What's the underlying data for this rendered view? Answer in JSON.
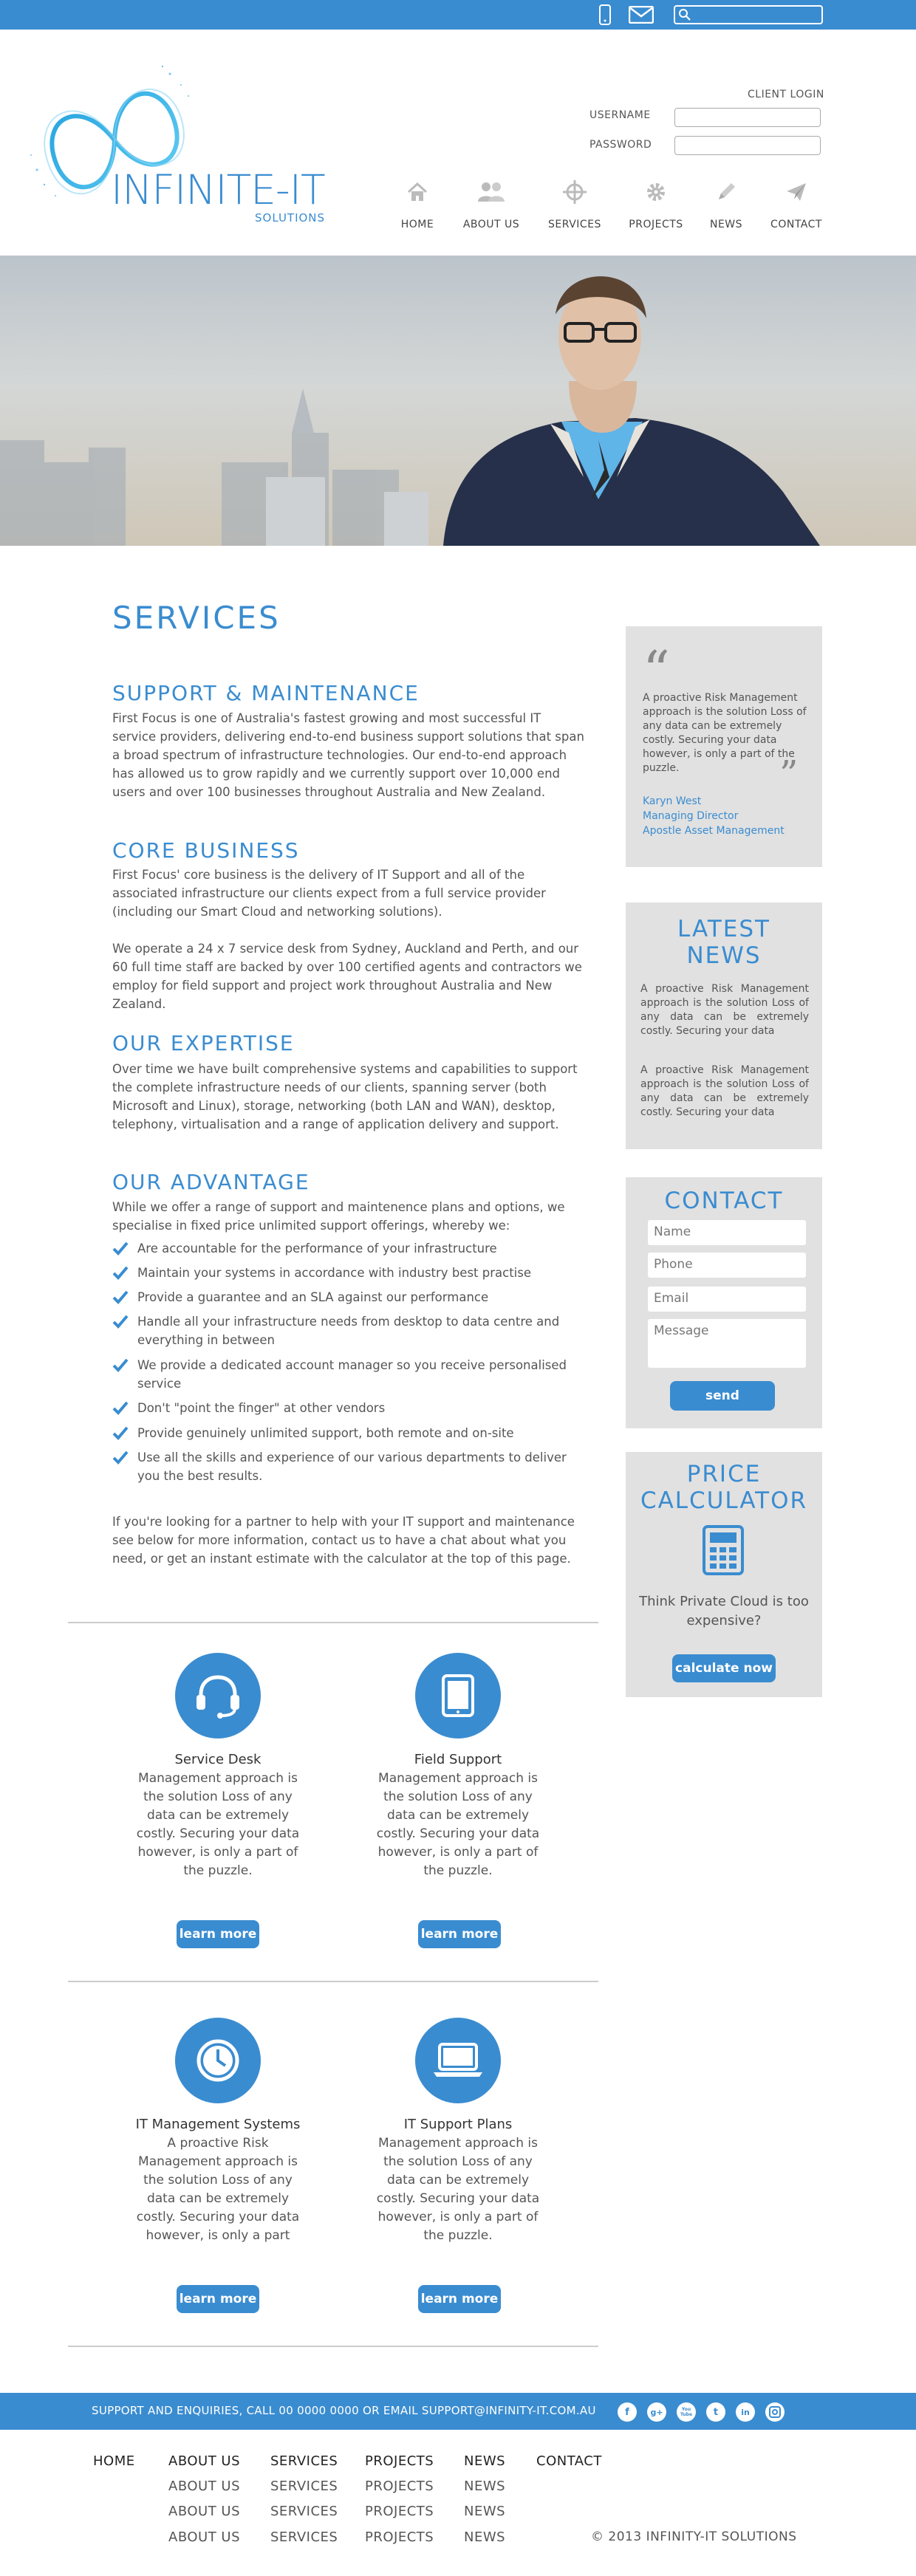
{
  "header": {
    "search_placeholder": "",
    "logo_text": "INFINITE-IT",
    "logo_sub": "SOLUTIONS",
    "client_login": "CLIENT LOGIN",
    "username_label": "USERNAME",
    "password_label": "PASSWORD"
  },
  "nav": [
    {
      "label": "HOME",
      "icon": "home-icon"
    },
    {
      "label": "ABOUT US",
      "icon": "users-icon"
    },
    {
      "label": "SERVICES",
      "icon": "crosshair-icon"
    },
    {
      "label": "PROJECTS",
      "icon": "gear-icon"
    },
    {
      "label": "NEWS",
      "icon": "pencil-icon"
    },
    {
      "label": "CONTACT",
      "icon": "paper-plane-icon"
    }
  ],
  "main": {
    "title": "SERVICES",
    "sections": [
      {
        "heading": "SUPPORT & MAINTENANCE",
        "paragraphs": [
          "First Focus is one of Australia's fastest growing and most successful IT service providers, delivering end-to-end business support solutions that span a broad spectrum of infrastructure technologies. Our end-to-end approach has allowed us to grow rapidly and we currently support over 10,000 end users and over 100 businesses throughout Australia and New Zealand."
        ]
      },
      {
        "heading": "CORE BUSINESS",
        "paragraphs": [
          "First Focus' core business is the delivery of IT Support and all of the associated infrastructure our clients expect from a full service provider (including our Smart Cloud and networking solutions).",
          "We operate a 24 x 7 service desk from Sydney, Auckland and Perth, and our 60 full time staff are backed by over 100 certified agents and contractors we employ for field support and project work throughout Australia and New Zealand."
        ]
      },
      {
        "heading": "OUR EXPERTISE",
        "paragraphs": [
          "Over time we have built comprehensive systems and capabilities to support the complete infrastructure needs of our clients, spanning server (both Microsoft and Linux), storage, networking (both LAN and WAN), desktop, telephony, virtualisation and a range of application delivery and support."
        ]
      },
      {
        "heading": "OUR ADVANTAGE",
        "paragraphs": [
          "While we offer a range of support and maintenence plans and options, we specialise in fixed price unlimited support offerings, whereby we:"
        ]
      }
    ],
    "advantages": [
      "Are accountable for the performance of your infrastructure",
      "Maintain your systems in accordance with industry best practise",
      "Provide a guarantee and an SLA against our performance",
      "Handle all your infrastructure needs from desktop to data centre and everything in between",
      "We provide a dedicated account manager so you receive personalised service",
      "Don't \"point the finger\" at other vendors",
      "Provide genuinely unlimited support, both remote and on-site",
      "Use all the skills and experience of our various departments to deliver you the best results."
    ],
    "closing": "If you're looking for a partner to help with your IT support and maintenance see below for more information, contact us to have a chat about what you need, or get an instant estimate with the calculator at the top of this page.",
    "services": [
      {
        "title": "Service Desk",
        "icon": "headset-icon",
        "text": "Management approach is the solution Loss of any data can be extremely costly. Securing your data however, is only a part of the puzzle.",
        "button": "learn more"
      },
      {
        "title": "Field Support",
        "icon": "tablet-icon",
        "text": "Management approach is the solution Loss of any data can be extremely costly. Securing your data however, is only a part of the puzzle.",
        "button": "learn more"
      },
      {
        "title": "IT Management Systems",
        "icon": "clock-icon",
        "text": "A proactive Risk Management approach is the solution Loss of any data can be extremely costly. Securing your data however, is only a part",
        "button": "learn more"
      },
      {
        "title": "IT Support Plans",
        "icon": "laptop-icon",
        "text": "Management approach is the solution Loss of any data can be extremely costly. Securing your data however, is only a part of the puzzle.",
        "button": "learn more"
      }
    ]
  },
  "sidebar": {
    "quote": {
      "text": "A proactive Risk Management approach is the solution Loss of any data can be extremely costly. Securing your data however, is only a part of the puzzle.",
      "author": "Karyn West",
      "role": "Managing Director",
      "company": "Apostle Asset Management"
    },
    "news": {
      "heading_line1": "LATEST",
      "heading_line2": "NEWS",
      "items": [
        "A proactive Risk Management approach is the solution Loss of any data can be extremely costly. Securing your data",
        "A proactive Risk Management approach is the solution Loss of any data can be extremely costly. Securing your data"
      ]
    },
    "contact": {
      "heading": "CONTACT",
      "name_placeholder": "Name",
      "phone_placeholder": "Phone",
      "email_placeholder": "Email",
      "message_placeholder": "Message",
      "send": "send"
    },
    "calculator": {
      "heading_line1": "PRICE",
      "heading_line2": "CALCULATOR",
      "text": "Think Private Cloud is too expensive?",
      "button": "calculate now"
    }
  },
  "footer": {
    "contact_text": "SUPPORT AND ENQUIRIES, CALL 00 0000 0000 OR EMAIL SUPPORT@INFINITY-IT.COM.AU",
    "social": [
      "f",
      "g+",
      "You Tube",
      "t",
      "in",
      "instagram"
    ],
    "nav": [
      "HOME",
      "ABOUT US",
      "SERVICES",
      "PROJECTS",
      "NEWS",
      "CONTACT"
    ],
    "sub": {
      "about": [
        "ABOUT US",
        "ABOUT US",
        "ABOUT US"
      ],
      "services": [
        "SERVICES",
        "SERVICES",
        "SERVICES"
      ],
      "projects": [
        "PROJECTS",
        "PROJECTS",
        "PROJECTS"
      ],
      "news": [
        "NEWS",
        "NEWS",
        "NEWS"
      ]
    },
    "copyright": "© 2013 INFINITY-IT SOLUTIONS"
  },
  "colors": {
    "accent": "#3a8cd0",
    "panel": "#e1e1e1"
  }
}
